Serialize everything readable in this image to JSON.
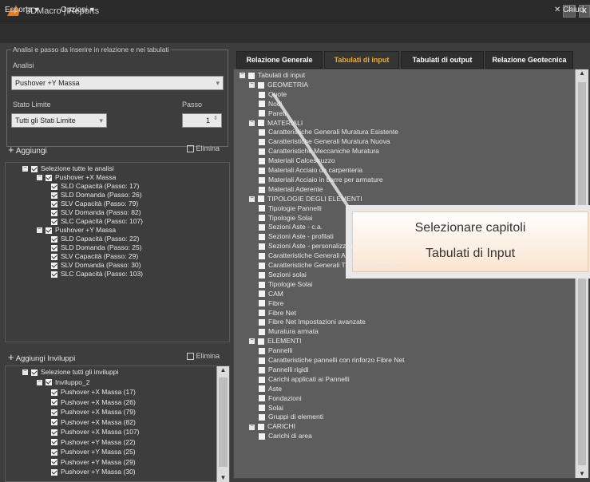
{
  "window": {
    "title": "3DMacro | Reports",
    "minimize": "–",
    "close": "x"
  },
  "menu": {
    "esporta": "Esporta",
    "opzioni": "Opzioni",
    "close_label": "Chiud"
  },
  "analysis": {
    "group_title": "Analisi e passo da inserire in relazione e nei tabulati",
    "analisi_label": "Analisi",
    "analisi_value": "Pushover +Y Massa",
    "stato_label": "Stato Limite",
    "stato_value": "Tutti gli Stati Limite",
    "passo_label": "Passo",
    "passo_value": "1",
    "add_label": "Aggiungi",
    "delete_label": "Elimina"
  },
  "analysis_tree": [
    {
      "level": 0,
      "text": "Selezione tutte le analisi"
    },
    {
      "level": 1,
      "text": "Pushover +X Massa"
    },
    {
      "level": 2,
      "text": "SLD Capacità (Passo: 17)"
    },
    {
      "level": 2,
      "text": "SLD Domanda (Passo: 26)"
    },
    {
      "level": 2,
      "text": "SLV Capacità (Passo: 79)"
    },
    {
      "level": 2,
      "text": "SLV Domanda (Passo: 82)"
    },
    {
      "level": 2,
      "text": "SLC Capacità (Passo: 107)"
    },
    {
      "level": 1,
      "text": "Pushover +Y Massa"
    },
    {
      "level": 2,
      "text": "SLD Capacità (Passo: 22)"
    },
    {
      "level": 2,
      "text": "SLD Domanda (Passo: 25)"
    },
    {
      "level": 2,
      "text": "SLV Capacità (Passo: 29)"
    },
    {
      "level": 2,
      "text": "SLV Domanda (Passo: 30)"
    },
    {
      "level": 2,
      "text": "SLC Capacità (Passo: 103)"
    }
  ],
  "envelopes": {
    "add_label": "Aggiungi Inviluppi",
    "delete_label": "Elimina",
    "items": [
      {
        "level": 0,
        "text": "Selezione tutti gli inviluppi"
      },
      {
        "level": 1,
        "text": "Inviluppo_2"
      },
      {
        "level": 2,
        "text": "Pushover +X Massa (17)"
      },
      {
        "level": 2,
        "text": "Pushover +X Massa (26)"
      },
      {
        "level": 2,
        "text": "Pushover +X Massa (79)"
      },
      {
        "level": 2,
        "text": "Pushover +X Massa (82)"
      },
      {
        "level": 2,
        "text": "Pushover +X Massa (107)"
      },
      {
        "level": 2,
        "text": "Pushover +Y Massa (22)"
      },
      {
        "level": 2,
        "text": "Pushover +Y Massa (25)"
      },
      {
        "level": 2,
        "text": "Pushover +Y Massa (29)"
      },
      {
        "level": 2,
        "text": "Pushover +Y Massa (30)"
      }
    ]
  },
  "tabs": [
    {
      "label": "Relazione Generale",
      "active": false
    },
    {
      "label": "Tabulati di input",
      "active": true
    },
    {
      "label": "Tabulati di output",
      "active": false
    },
    {
      "label": "Relazione Geotecnica",
      "active": false
    }
  ],
  "input_tree": [
    {
      "level": 0,
      "text": "Tabulati di input"
    },
    {
      "level": 1,
      "text": "GEOMETRIA"
    },
    {
      "level": 2,
      "text": "Quote"
    },
    {
      "level": 2,
      "text": "Nodi"
    },
    {
      "level": 2,
      "text": "Pareti"
    },
    {
      "level": 1,
      "text": "MATERIALI"
    },
    {
      "level": 2,
      "text": "Caratteristiche Generali Muratura Esistente"
    },
    {
      "level": 2,
      "text": "Caratteristiche Generali Muratura Nuova"
    },
    {
      "level": 2,
      "text": "Caratteristiche Meccaniche Muratura"
    },
    {
      "level": 2,
      "text": "Materiali Calcestruzzo"
    },
    {
      "level": 2,
      "text": "Materiali Acciaio da carpenteria"
    },
    {
      "level": 2,
      "text": "Materiali Acciaio in barre per armature"
    },
    {
      "level": 2,
      "text": "Materiali Aderente"
    },
    {
      "level": 1,
      "text": "TIPOLOGIE DEGLI ELEMENTI"
    },
    {
      "level": 2,
      "text": "Tipologie Pannelli"
    },
    {
      "level": 2,
      "text": "Tipologie Solai"
    },
    {
      "level": 2,
      "text": "Sezioni Aste - c.a."
    },
    {
      "level": 2,
      "text": "Sezioni Aste - profilati"
    },
    {
      "level": 2,
      "text": "Sezioni Aste - personalizzate"
    },
    {
      "level": 2,
      "text": "Caratteristiche Generali Aste"
    },
    {
      "level": 2,
      "text": "Caratteristiche Generali Tipologie Fondazioni"
    },
    {
      "level": 2,
      "text": "Sezioni solai"
    },
    {
      "level": 2,
      "text": "Tipologie Solai"
    },
    {
      "level": 2,
      "text": "CAM"
    },
    {
      "level": 2,
      "text": "Fibre"
    },
    {
      "level": 2,
      "text": "Fibre Net"
    },
    {
      "level": 2,
      "text": "Fibre Net Impostazioni avanzate"
    },
    {
      "level": 2,
      "text": "Muratura armata"
    },
    {
      "level": 1,
      "text": "ELEMENTI"
    },
    {
      "level": 2,
      "text": "Pannelli"
    },
    {
      "level": 2,
      "text": "Caratteristiche pannelli con rinforzo Fibre Net"
    },
    {
      "level": 2,
      "text": "Pannelli rigidi"
    },
    {
      "level": 2,
      "text": "Carichi applicati ai Pannelli"
    },
    {
      "level": 2,
      "text": "Aste"
    },
    {
      "level": 2,
      "text": "Fondazioni"
    },
    {
      "level": 2,
      "text": "Solai"
    },
    {
      "level": 2,
      "text": "Gruppi di elementi"
    },
    {
      "level": 1,
      "text": "CARICHI"
    },
    {
      "level": 2,
      "text": "Carichi di area"
    }
  ],
  "callout": {
    "line1": "Selezionare capitoli",
    "line2": "Tabulati di Input"
  }
}
